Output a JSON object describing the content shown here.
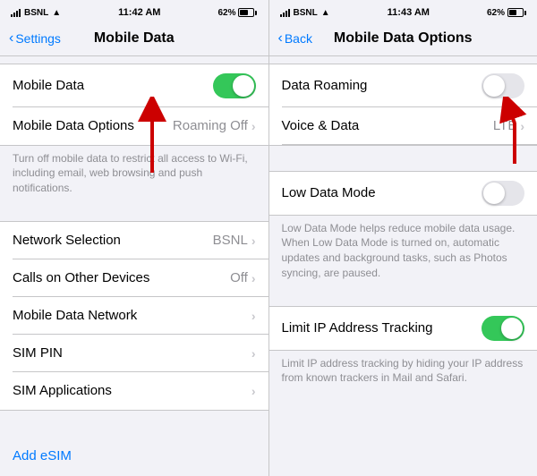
{
  "screen1": {
    "statusBar": {
      "carrier": "BSNL",
      "time": "11:42 AM",
      "battery": "62%"
    },
    "nav": {
      "backLabel": "Settings",
      "title": "Mobile Data"
    },
    "rows": [
      {
        "label": "Mobile Data",
        "type": "toggle",
        "toggleState": "on",
        "value": ""
      },
      {
        "label": "Mobile Data Options",
        "type": "value-chevron",
        "value": "Roaming Off"
      }
    ],
    "description": "Turn off mobile data to restrict all access to Wi-Fi, including email, web browsing and push notifications.",
    "rows2": [
      {
        "label": "Network Selection",
        "type": "value-chevron",
        "value": "BSNL"
      },
      {
        "label": "Calls on Other Devices",
        "type": "value-chevron",
        "value": "Off"
      },
      {
        "label": "Mobile Data Network",
        "type": "chevron",
        "value": ""
      },
      {
        "label": "SIM PIN",
        "type": "chevron",
        "value": ""
      },
      {
        "label": "SIM Applications",
        "type": "chevron",
        "value": ""
      }
    ],
    "addEsim": "Add eSIM"
  },
  "screen2": {
    "statusBar": {
      "carrier": "BSNL",
      "time": "11:43 AM",
      "battery": "62%"
    },
    "nav": {
      "backLabel": "Back",
      "title": "Mobile Data Options"
    },
    "rows1": [
      {
        "label": "Data Roaming",
        "type": "toggle",
        "toggleState": "off"
      },
      {
        "label": "Voice & Data",
        "type": "value-chevron",
        "value": "LTE"
      }
    ],
    "rows2label": "Low Data Mode",
    "rows2": [
      {
        "label": "Low Data Mode",
        "type": "toggle",
        "toggleState": "off"
      }
    ],
    "lowDataDesc": "Low Data Mode helps reduce mobile data usage. When Low Data Mode is turned on, automatic updates and background tasks, such as Photos syncing, are paused.",
    "rows3": [
      {
        "label": "Limit IP Address Tracking",
        "type": "toggle",
        "toggleState": "on"
      }
    ],
    "limitDesc": "Limit IP address tracking by hiding your IP address from known trackers in Mail and Safari."
  }
}
